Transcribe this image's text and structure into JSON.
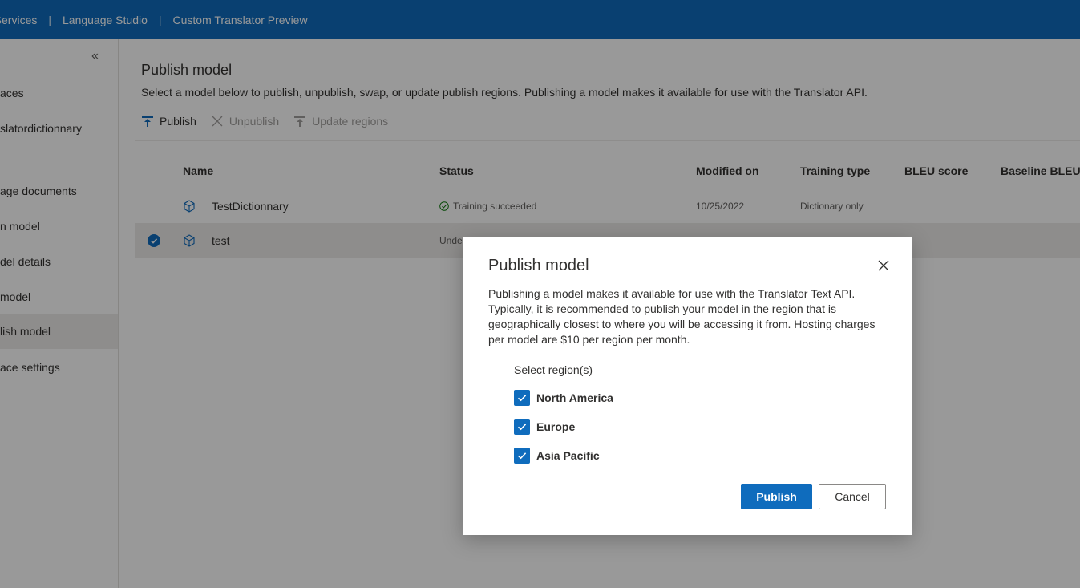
{
  "topbar": {
    "crumbs": [
      "e Services",
      "Language Studio",
      "Custom Translator Preview"
    ]
  },
  "sidebar": {
    "collapse_glyph": "«",
    "items": [
      {
        "label": "aces",
        "active": false
      },
      {
        "label": "slatordictionnary",
        "active": false
      },
      {
        "label": "age documents",
        "active": false
      },
      {
        "label": "n model",
        "active": false
      },
      {
        "label": "del details",
        "active": false
      },
      {
        "label": " model",
        "active": false
      },
      {
        "label": "lish model",
        "active": true
      },
      {
        "label": "ace settings",
        "active": false
      }
    ]
  },
  "main": {
    "title": "Publish model",
    "description": "Select a model below to publish, unpublish, swap, or update publish regions. Publishing a model makes it available for use with the Translator API.",
    "toolbar": {
      "publish_label": "Publish",
      "unpublish_label": "Unpublish",
      "update_regions_label": "Update regions"
    },
    "table": {
      "columns": [
        "Name",
        "Status",
        "Modified on",
        "Training type",
        "BLEU score",
        "Baseline BLEU"
      ],
      "rows": [
        {
          "name": "TestDictionnary",
          "status": "Training succeeded",
          "modified": "10/25/2022",
          "training_type": "Dictionary only",
          "bleu": "",
          "baseline": "",
          "selected": false
        },
        {
          "name": "test",
          "status": "Unde",
          "modified": "",
          "training_type": "",
          "bleu": "",
          "baseline": "",
          "selected": true
        }
      ]
    }
  },
  "dialog": {
    "title": "Publish model",
    "body": "Publishing a model makes it available for use with the Translator Text API. Typically, it is recommended to publish your model in the region that is geographically closest to where you will be accessing it from. Hosting charges per model are $10 per region per month.",
    "region_label": "Select region(s)",
    "regions": [
      {
        "label": "North America",
        "checked": true
      },
      {
        "label": "Europe",
        "checked": true
      },
      {
        "label": "Asia Pacific",
        "checked": true
      }
    ],
    "publish_button": "Publish",
    "cancel_button": "Cancel"
  },
  "colors": {
    "accent": "#0f6cbd",
    "success": "#107c10"
  }
}
